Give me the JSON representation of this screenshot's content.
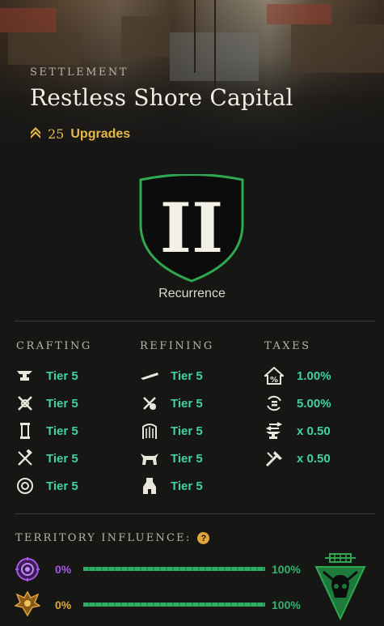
{
  "header": {
    "section_label": "SETTLEMENT",
    "title": "Restless Shore Capital",
    "upgrades_count": "25",
    "upgrades_label": "Upgrades",
    "upgrade_icon": "chevron-rank-icon"
  },
  "shield": {
    "numeral": "II",
    "name": "Recurrence",
    "border_color": "#2fa84f"
  },
  "crafting": {
    "heading": "CRAFTING",
    "rows": [
      {
        "icon": "anvil-icon",
        "value": "Tier 5"
      },
      {
        "icon": "crossed-tools-icon",
        "value": "Tier 5"
      },
      {
        "icon": "scroll-icon",
        "value": "Tier 5"
      },
      {
        "icon": "sword-hammer-icon",
        "value": "Tier 5"
      },
      {
        "icon": "trinket-ring-icon",
        "value": "Tier 5"
      }
    ]
  },
  "refining": {
    "heading": "REFINING",
    "rows": [
      {
        "icon": "saw-blade-icon",
        "value": "Tier 5"
      },
      {
        "icon": "smelter-icon",
        "value": "Tier 5"
      },
      {
        "icon": "loom-icon",
        "value": "Tier 5"
      },
      {
        "icon": "tannery-hide-icon",
        "value": "Tier 5"
      },
      {
        "icon": "stonecutter-icon",
        "value": "Tier 5"
      }
    ]
  },
  "taxes": {
    "heading": "TAXES",
    "rows": [
      {
        "icon": "property-tax-icon",
        "value": "1.00%"
      },
      {
        "icon": "trading-tax-icon",
        "value": "5.00%"
      },
      {
        "icon": "crafting-fee-icon",
        "value": "x 0.50"
      },
      {
        "icon": "refining-fee-icon",
        "value": "x 0.50"
      }
    ]
  },
  "territory": {
    "heading": "TERRITORY INFLUENCE:",
    "help_glyph": "?",
    "factions": [
      {
        "icon": "syndicate-eye-icon",
        "percent": "0%",
        "max": "100%",
        "color": "#a855e8",
        "fill": 1.0
      },
      {
        "icon": "covenant-phoenix-icon",
        "percent": "0%",
        "max": "100%",
        "color": "#e0a63b",
        "fill": 1.0
      }
    ],
    "owner_icon": "marauders-skull-icon",
    "owner_color": "#2fa84f"
  }
}
